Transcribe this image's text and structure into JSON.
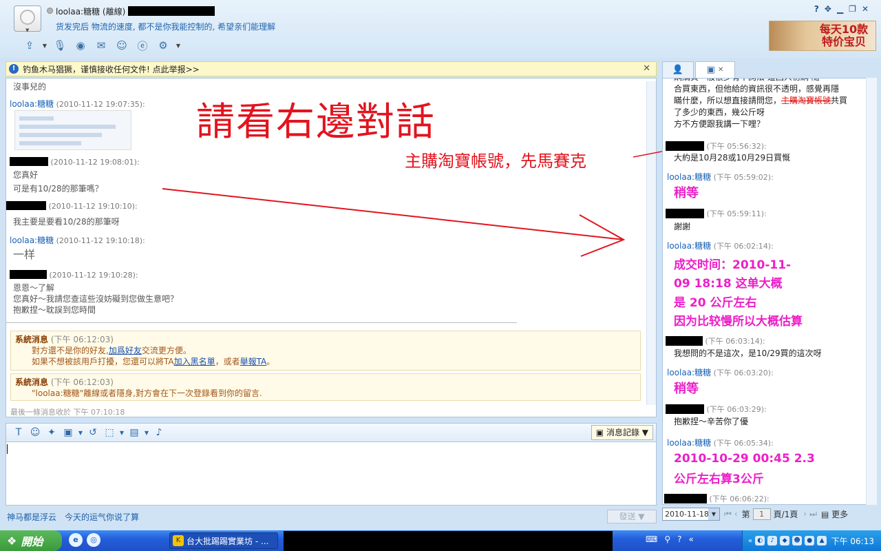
{
  "header": {
    "contact_name": "loolaa:糖糖 (離線)",
    "signature": "货发完后 物流的速度, 都不是你我能控制的, 希望亲们能理解",
    "ad_text": "每天10款 特价宝贝"
  },
  "toolbar": {
    "icons": [
      "file-transfer-icon",
      "voice-icon",
      "video-icon",
      "email-icon",
      "add-contact-icon",
      "ie-icon",
      "app-icon"
    ]
  },
  "warning": {
    "text": "钓鱼木马猖獗，谨慎接收任何文件! 点此举报>>"
  },
  "annotation": {
    "title": "請看右邊對話",
    "subtitle": "主購淘寶帳號，先馬賽克"
  },
  "chat": {
    "top_fragment": "沒事兒的",
    "messages": [
      {
        "nick": "loolaa:糖糖",
        "time": "(2010-11-12 19:07:35):"
      },
      {
        "nick": "",
        "time": "(2010-11-12 19:08:01):",
        "lines": [
          "您真好",
          "可是有10/28的那筆嗎？"
        ]
      },
      {
        "nick": "",
        "time": "(2010-11-12 19:10:10):",
        "lines": [
          "我主要是要看10/28的那筆呀"
        ]
      },
      {
        "nick": "loolaa:糖糖",
        "time": "(2010-11-12 19:10:18):",
        "lines": [
          "一样"
        ]
      },
      {
        "nick": "",
        "time": "(2010-11-12 19:10:28):",
        "lines": [
          "恩恩～了解",
          "您真好～我請您查這些沒妨礙到您做生意吧？",
          "抱歉捏～耽誤到您時間"
        ]
      }
    ],
    "system_messages": [
      {
        "title": "系統消息",
        "time": "(下午 06:12:03)",
        "line1_pre": "對方還不是你的好友,",
        "line1_link": "加爲好友",
        "line1_post": "交流更方便。",
        "line2_pre": "如果不想被該用戶打擾，您還可以將TA",
        "line2_link1": "加入黑名單",
        "line2_mid": "，或者",
        "line2_link2": "舉報TA",
        "line2_post": "。"
      },
      {
        "title": "系統消息",
        "time": "(下午 06:12:03)",
        "line1": "\"loolaa:糖糖\"離線或者隱身,對方會在下一次登錄看到你的留言."
      }
    ],
    "last_message_label": "最後一條消息收於  下午  07:10:18"
  },
  "input": {
    "history_label": "消息記錄",
    "send_label": "發送",
    "footer_left": "神马都是浮云",
    "footer_right": "今天的运气你说了算"
  },
  "right_panel": {
    "top_lines": [
      "網購買一般很少有不詢法 這回人初網 隨",
      "合買東西，但他給的資訊很不透明，感覺再隱",
      "瞞什麼，所以想直接請問您，",
      "了多少的東西，幾公斤呀",
      "方不方便跟我講一下哩？"
    ],
    "top_line3_struck": "主購淘寶帳號",
    "top_line3_suffix": "共買",
    "entries": [
      {
        "nick": "",
        "time": "(下午 05:56:32):",
        "text": "大約是10月28或10月29日買慨"
      },
      {
        "nick": "loolaa:糖糖",
        "time": "(下午 05:59:02):",
        "pink": "稍等"
      },
      {
        "nick": "",
        "time": "(下午 05:59:11):",
        "text": "謝謝"
      },
      {
        "nick": "loolaa:糖糖",
        "time": "(下午 06:02:14):",
        "pink_lines": [
          "成交时间：2010-11-",
          "09 18:18    这单大概",
          "是 20 公斤左右",
          "因为比较慢所以大概估算"
        ]
      },
      {
        "nick": "",
        "time": "(下午 06:03:14):",
        "text": "我想問的不是這次，是10/29買的這次呀"
      },
      {
        "nick": "loolaa:糖糖",
        "time": "(下午 06:03:20):",
        "pink": "稍等"
      },
      {
        "nick": "",
        "time": "(下午 06:03:29):",
        "text": "抱歉捏～辛苦你了優"
      },
      {
        "nick": "loolaa:糖糖",
        "time": "(下午 06:05:34):",
        "pink_lines": [
          "2010-10-29 00:45    2.3",
          "公斤左右算3公斤"
        ]
      },
      {
        "nick": "",
        "time": "(下午 06:06:22):"
      }
    ],
    "nav": {
      "date": "2010-11-18",
      "page_prefix": "第",
      "page_value": "1",
      "page_suffix": "頁/1頁",
      "more_label": "更多"
    }
  },
  "taskbar": {
    "start_label": "開始",
    "task_label": "台大批踢踢實業坊 - ...",
    "clock": "下午 06:13"
  }
}
